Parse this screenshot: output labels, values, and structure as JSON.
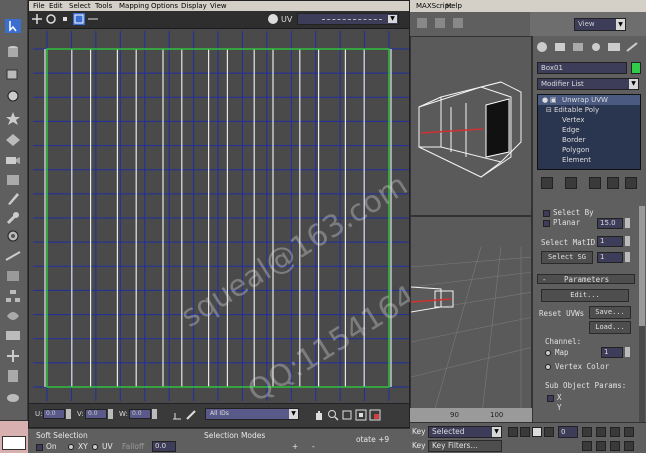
{
  "uv_editor": {
    "menu": [
      "File",
      "Edit",
      "Select",
      "Tools",
      "Mapping",
      "Options",
      "Display",
      "View"
    ],
    "coords": {
      "u_label": "U:",
      "v_label": "V:",
      "w_label": "W:",
      "u_value": "0.0",
      "v_value": "0.0",
      "w_value": "0.0"
    },
    "id_filter": "All IDs",
    "grid": {
      "columns": 14,
      "rows": 14,
      "uv_columns": 15
    }
  },
  "watermark": {
    "line1": "squeal@163.com",
    "line2": "QQ:115416493"
  },
  "max": {
    "menu": [
      "MAXScript",
      "Help"
    ],
    "view_dropdown": "View",
    "ruler": {
      "ticks": [
        "90",
        "100"
      ]
    }
  },
  "command_panel": {
    "object_name": "Box01",
    "object_color": "#2ecc4a",
    "modifier_list": "Modifier List",
    "stack": [
      "Unwrap UVW",
      "Editable Poly",
      "Vertex",
      "Edge",
      "Border",
      "Polygon",
      "Element"
    ],
    "select_by": "Select By",
    "planar_label": "Planar",
    "planar_value": "15.0",
    "select_matid": "Select MatID",
    "select_matid_value": "1",
    "select_sg": "Select SG",
    "select_sg_value": "1",
    "parameters": "Parameters",
    "edit_button": "Edit...",
    "reset_uvws": "Reset UVWs",
    "save_button": "Save...",
    "load_button": "Load...",
    "channel_label": "Channel:",
    "map_label": "Map",
    "map_value": "1",
    "vertex_color": "Vertex Color",
    "sub_object_params": "Sub Object Params:",
    "x_label": "X",
    "y_label": "Y"
  },
  "soft_selection": {
    "title": "Soft Selection",
    "on_label": "On",
    "xy_label": "XY",
    "uv_label": "UV",
    "falloff_label": "Falloff",
    "falloff_value": "0.0",
    "selection_modes": "Selection Modes",
    "rotate": "otate +9"
  },
  "anim": {
    "key_label_1": "Key",
    "key_label_2": "Key",
    "selected": "Selected",
    "key_filters": "Key Filters...",
    "frame": "0"
  }
}
